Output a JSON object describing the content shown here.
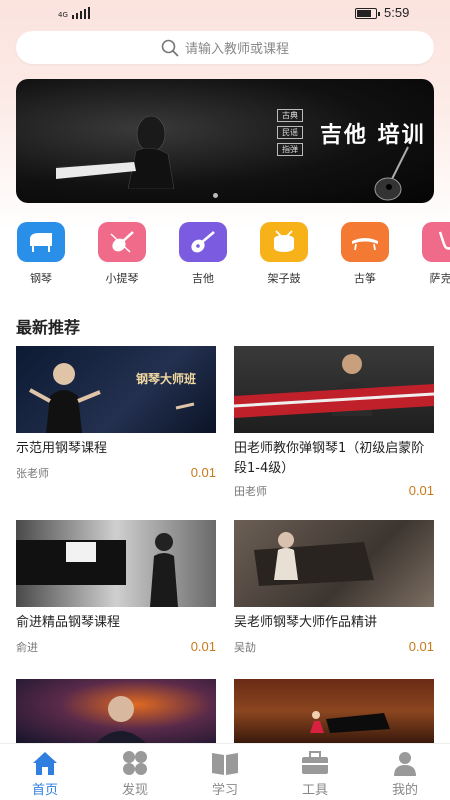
{
  "status_bar": {
    "network": "4G",
    "time": "5:59"
  },
  "search": {
    "placeholder": "请输入教师或课程"
  },
  "banner": {
    "title": "吉他 培训",
    "tags": [
      "古典",
      "民谣",
      "指弹"
    ]
  },
  "categories": [
    {
      "label": "钢琴",
      "icon": "grand-piano-icon",
      "color": "#2a8fe8"
    },
    {
      "label": "小提琴",
      "icon": "violin-icon",
      "color": "#f06a8a"
    },
    {
      "label": "吉他",
      "icon": "guitar-icon",
      "color": "#7b5ce0"
    },
    {
      "label": "架子鼓",
      "icon": "drum-icon",
      "color": "#f7b21a"
    },
    {
      "label": "古筝",
      "icon": "guzheng-icon",
      "color": "#f47a33"
    },
    {
      "label": "萨克斯",
      "icon": "saxophone-icon",
      "color": "#f06a8a"
    }
  ],
  "section_title": "最新推荐",
  "courses": [
    {
      "title": "示范用钢琴课程",
      "teacher": "张老师",
      "price": "0.01",
      "thumb_text": "钢琴大师班"
    },
    {
      "title": "田老师教你弹钢琴1（初级启蒙阶段1-4级）",
      "teacher": "田老师",
      "price": "0.01"
    },
    {
      "title": "俞进精品钢琴课程",
      "teacher": "俞进",
      "price": "0.01"
    },
    {
      "title": "吴老师钢琴大师作品精讲",
      "teacher": "吴劼",
      "price": "0.01"
    },
    {
      "title": "",
      "teacher": "",
      "price": ""
    },
    {
      "title": "",
      "teacher": "",
      "price": ""
    }
  ],
  "tabs": [
    {
      "label": "首页",
      "icon": "home-icon",
      "active": true
    },
    {
      "label": "发现",
      "icon": "discover-icon",
      "active": false
    },
    {
      "label": "学习",
      "icon": "book-icon",
      "active": false
    },
    {
      "label": "工具",
      "icon": "toolbox-icon",
      "active": false
    },
    {
      "label": "我的",
      "icon": "profile-icon",
      "active": false
    }
  ],
  "colors": {
    "accent": "#2f7fe0",
    "price": "#c97a1a"
  }
}
